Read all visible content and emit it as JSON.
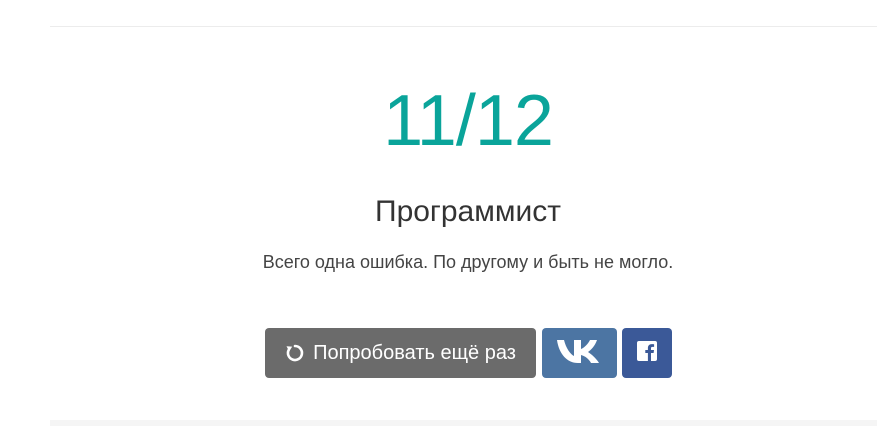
{
  "result": {
    "score": "11/12",
    "title": "Программист",
    "description": "Всего одна ошибка. По другому и быть не могло."
  },
  "actions": {
    "retry_label": "Попробовать ещё раз",
    "retry_icon": "refresh-icon",
    "share_vk_icon": "vk-logo-icon",
    "share_fb_icon": "facebook-logo-icon"
  },
  "colors": {
    "score": "#0aa49a",
    "retry_button": "#6b6b6b",
    "vk_button": "#4c75a3",
    "fb_button": "#3b5998"
  }
}
